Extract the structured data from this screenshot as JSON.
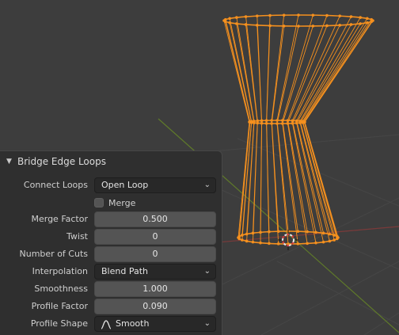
{
  "panel": {
    "title": "Bridge Edge Loops",
    "connect_loops": {
      "label": "Connect Loops",
      "value": "Open Loop"
    },
    "merge": {
      "label": "Merge",
      "checked": false
    },
    "merge_factor": {
      "label": "Merge Factor",
      "value": "0.500"
    },
    "twist": {
      "label": "Twist",
      "value": "0"
    },
    "number_of_cuts": {
      "label": "Number of Cuts",
      "value": "0"
    },
    "interpolation": {
      "label": "Interpolation",
      "value": "Blend Path"
    },
    "smoothness": {
      "label": "Smoothness",
      "value": "1.000"
    },
    "profile_factor": {
      "label": "Profile Factor",
      "value": "0.090"
    },
    "profile_shape": {
      "label": "Profile Shape",
      "value": "Smooth",
      "icon": "smooth-curve-icon"
    }
  },
  "colors": {
    "viewport_bg": "#3d3d3d",
    "mesh_selected": "#f5901e",
    "x_axis": "#7a3a3a",
    "y_axis": "#5f7a2a",
    "panel_bg": "#2f2f2f"
  }
}
